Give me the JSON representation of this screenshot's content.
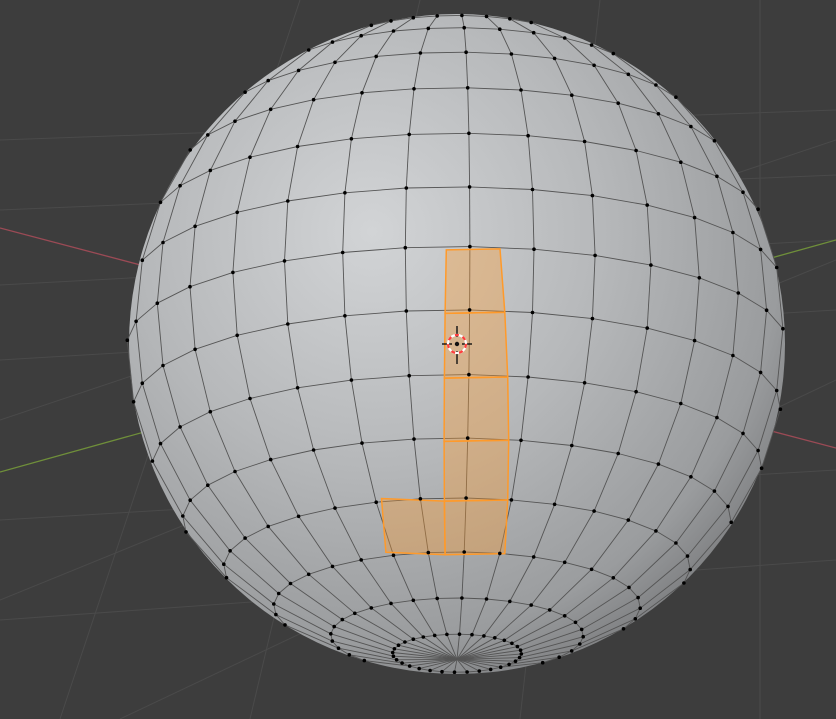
{
  "viewport": {
    "background_color": "#3d3d3d",
    "grid_color": "#4a4a4a",
    "x_axis_color": "#9b4a55",
    "y_axis_color": "#6f8f3a"
  },
  "mesh": {
    "object_type": "uv-sphere",
    "segments": 32,
    "rings": 16,
    "surface_color": "#b4b6b8",
    "edge_color": "#555555",
    "vertex_color": "#000000",
    "selection_color": "#ff9a2a",
    "selected_face_count": 6
  },
  "cursor_3d": {
    "icon": "3d-cursor-icon",
    "ring_colors": [
      "#ff3d3d",
      "#ffffff"
    ]
  }
}
